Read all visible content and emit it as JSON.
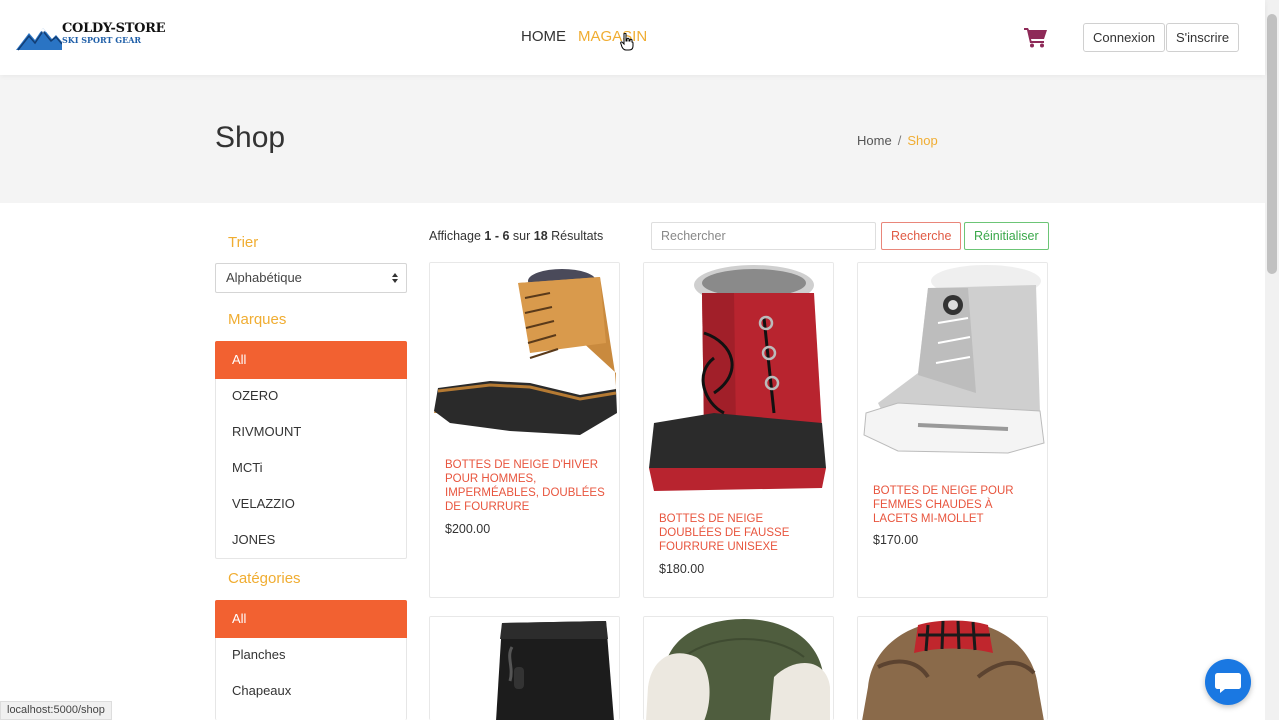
{
  "nav": {
    "logo_title": "COLDY-STORE",
    "logo_subtitle": "SKI SPORT GEAR",
    "links": [
      "HOME",
      "MAGASIN"
    ],
    "login_label": "Connexion",
    "signup_label": "S'inscrire"
  },
  "header": {
    "title": "Shop",
    "breadcrumb_home": "Home",
    "breadcrumb_sep": "/",
    "breadcrumb_current": "Shop"
  },
  "sidebar": {
    "sort_title": "Trier",
    "sort_value": "Alphabétique",
    "brands_title": "Marques",
    "brands": [
      "All",
      "OZERO",
      "RIVMOUNT",
      "MCTi",
      "VELAZZIO",
      "JONES"
    ],
    "categories_title": "Catégories",
    "categories": [
      "All",
      "Planches",
      "Chapeaux"
    ]
  },
  "toolbar": {
    "result_prefix": "Affichage",
    "result_range": "1 - 6",
    "result_mid": "sur",
    "result_total": "18",
    "result_suffix": "Résultats",
    "search_placeholder": "Rechercher",
    "search_label": "Recherche",
    "reset_label": "Réinitialiser"
  },
  "products": [
    {
      "name": "BOTTES DE NEIGE D'HIVER POUR HOMMES, IMPERMÉABLES, DOUBLÉES DE FOURRURE",
      "price": "$200.00"
    },
    {
      "name": "BOTTES DE NEIGE DOUBLÉES DE FAUSSE FOURRURE UNISEXE",
      "price": "$180.00"
    },
    {
      "name": "BOTTES DE NEIGE POUR FEMMES CHAUDES À LACETS MI-MOLLET",
      "price": "$170.00"
    }
  ],
  "status_url": "localhost:5000/shop",
  "colors": {
    "accent": "#f0ad32",
    "primary": "#f26131",
    "product_name": "#e8553e",
    "cart": "#8e2a58",
    "chat": "#1a78e2"
  }
}
